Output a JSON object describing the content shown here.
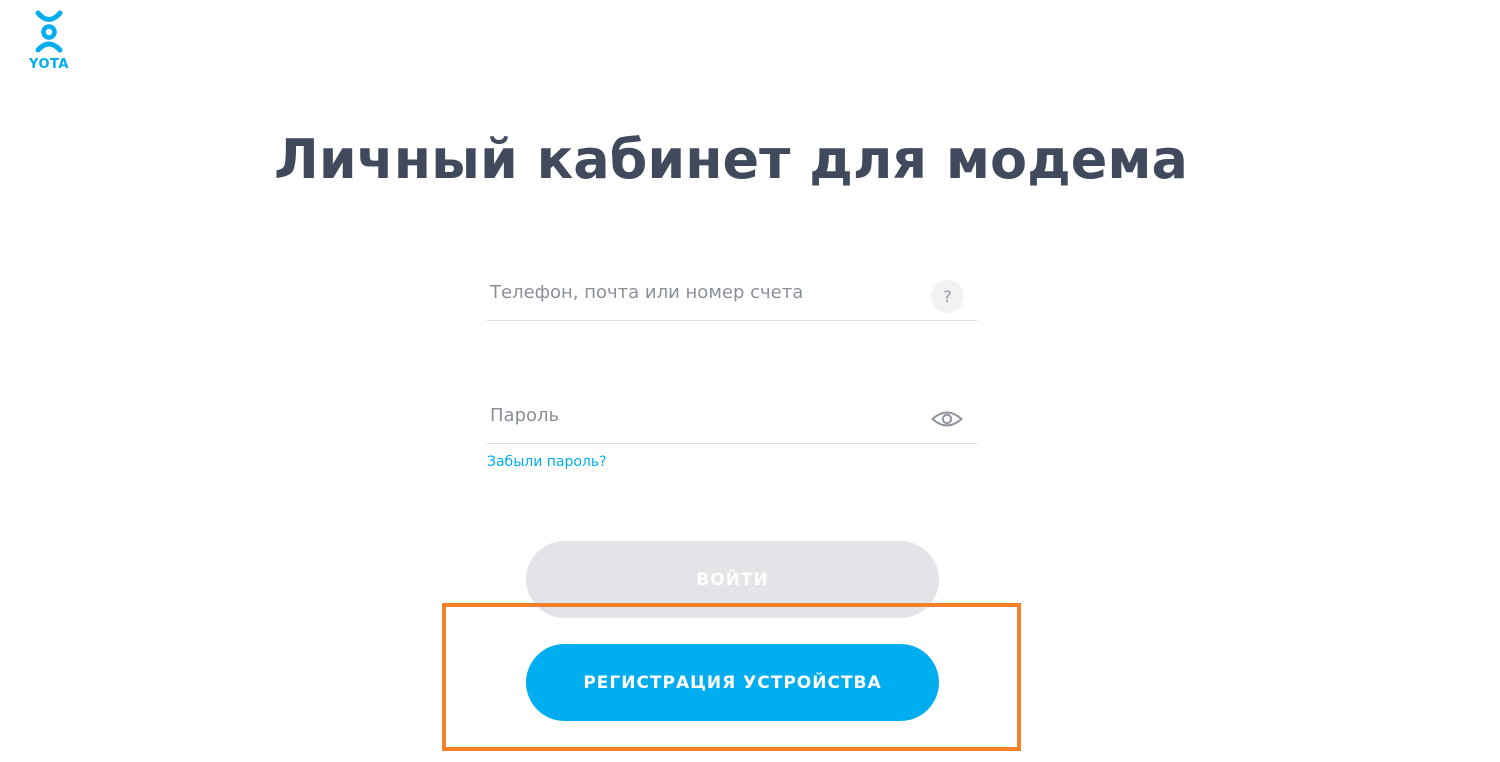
{
  "logo": {
    "text": "YOTA",
    "icon": "yota-logo-icon",
    "color": "#00aeef"
  },
  "page": {
    "title": "Личный кабинет для модема"
  },
  "form": {
    "login": {
      "placeholder": "Телефон, почта или номер счета",
      "value": "",
      "help_glyph": "?"
    },
    "password": {
      "placeholder": "Пароль",
      "value": "",
      "toggle_icon": "eye-icon"
    },
    "forgot_password_label": "Забыли пароль?",
    "login_button_label": "ВОЙТИ",
    "register_button_label": "РЕГИСТРАЦИЯ УСТРОЙСТВА"
  },
  "colors": {
    "accent": "#00aeef",
    "title": "#414a5c",
    "disabled_button": "#e3e4e7",
    "highlight": "#f5822a"
  }
}
